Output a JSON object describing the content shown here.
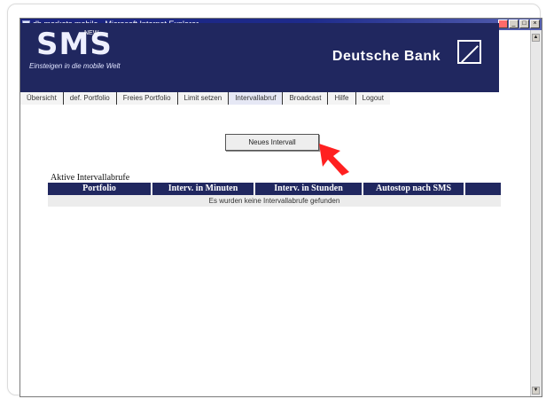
{
  "window": {
    "title": "db markets mobile - Microsoft Internet Explorer",
    "buttons": [
      "_",
      "□",
      "×"
    ]
  },
  "banner": {
    "logo": "SMS",
    "logo_badge": "NEW",
    "tagline": "Einsteigen in die mobile Welt",
    "brand": "Deutsche Bank"
  },
  "tabs": [
    {
      "label": "Übersicht",
      "active": false
    },
    {
      "label": "def. Portfolio",
      "active": false
    },
    {
      "label": "Freies Portfolio",
      "active": false
    },
    {
      "label": "Limit setzen",
      "active": false
    },
    {
      "label": "Intervallabruf",
      "active": true
    },
    {
      "label": "Broadcast",
      "active": false
    },
    {
      "label": "Hilfe",
      "active": false
    },
    {
      "label": "Logout",
      "active": false
    }
  ],
  "main": {
    "new_button_label": "Neues Intervall",
    "section_title": "Aktive Intervallabrufe",
    "columns": [
      "Portfolio",
      "Interv. in Minuten",
      "Interv. in Stunden",
      "Autostop nach SMS",
      ""
    ],
    "empty_message": "Es wurden keine Intervallabrufe gefunden"
  },
  "colors": {
    "brand_navy": "#20275f",
    "pointer_arrow": "#ff2020"
  }
}
